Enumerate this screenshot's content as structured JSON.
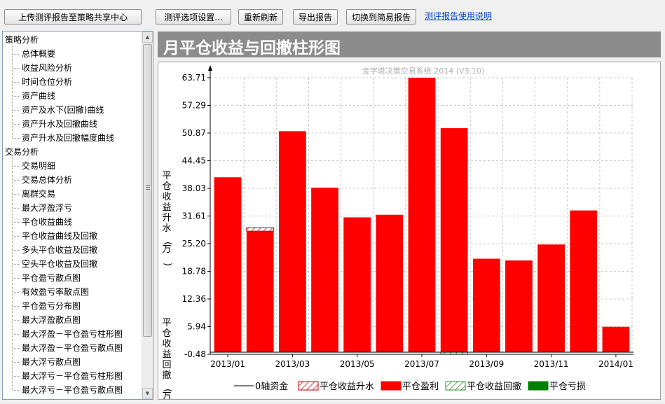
{
  "toolbar": {
    "upload_label": "上传测评报告至策略共享中心",
    "settings_label": "测评选项设置...",
    "refresh_label": "重新刷新",
    "export_label": "导出报告",
    "switch_label": "切换到简易报告",
    "help_link": "测评报告使用说明"
  },
  "sidebar": {
    "groups": [
      {
        "label": "策略分析",
        "items": [
          "总体概要",
          "收益风险分析",
          "时间仓位分析",
          "资产曲线",
          "资产及水下(回撤)曲线",
          "资产升水及回撤曲线",
          "资产升水及回撤幅度曲线"
        ]
      },
      {
        "label": "交易分析",
        "items": [
          "交易明细",
          "交易总体分析",
          "离群交易",
          "最大浮盈浮亏",
          "平仓收益曲线",
          "平仓收益曲线及回撤",
          "多头平仓收益及回撤",
          "空头平仓收益及回撤",
          "平仓盈亏散点图",
          "有效盈亏率散点图",
          "平仓盈亏分布图",
          "最大浮盈散点图",
          "最大浮盈－平仓盈亏柱形图",
          "最大浮盈－平仓盈亏散点图",
          "最大浮亏散点图",
          "最大浮亏－平仓盈亏柱形图",
          "最大浮亏－平仓盈亏散点图"
        ]
      }
    ]
  },
  "title_banner": "月平仓收益与回撤柱形图",
  "colors": {
    "profit": "#ff0000",
    "loss": "#008000",
    "rise_hatch": "#cc0000",
    "drawdown_hatch": "#2e8b2e",
    "banner": "#8c8c8c"
  },
  "chart_data": {
    "type": "bar",
    "watermark": "金字塔决策交易系统 2014 (V3.10)",
    "ylabel_top": "平仓收益升水(万)",
    "ylabel_bottom": "平仓收益回撤(万)",
    "y_ticks": [
      "63.71",
      "57.29",
      "50.87",
      "44.45",
      "38.03",
      "31.61",
      "25.20",
      "18.78",
      "12.36",
      "5.94",
      "-0.48"
    ],
    "ylim": [
      -0.48,
      63.71
    ],
    "x_tick_labels": [
      "2013/01",
      "2013/03",
      "2013/05",
      "2013/07",
      "2013/09",
      "2013/11",
      "2014/01"
    ],
    "categories": [
      "2013/01",
      "2013/02",
      "2013/03",
      "2013/04",
      "2013/05",
      "2013/06",
      "2013/07",
      "2013/08",
      "2013/09",
      "2013/10",
      "2013/11",
      "2013/12",
      "2014/01"
    ],
    "series": [
      {
        "name": "平仓盈利",
        "values": [
          40.6,
          28.1,
          51.3,
          38.2,
          31.3,
          31.9,
          63.7,
          52.0,
          21.7,
          21.3,
          25.0,
          32.9,
          5.9
        ]
      },
      {
        "name": "平仓收益升水",
        "values": [
          0,
          0.5,
          0,
          0,
          0,
          0,
          0,
          0,
          0,
          0,
          0,
          0,
          0
        ]
      },
      {
        "name": "平仓收益回撤",
        "values": [
          0,
          0,
          0,
          0,
          0,
          0,
          0,
          -0.45,
          0,
          0,
          0,
          0,
          0
        ]
      },
      {
        "name": "平仓亏损",
        "values": [
          0,
          0,
          0,
          0,
          0,
          0,
          0,
          0,
          0,
          0,
          0,
          0,
          0
        ]
      }
    ],
    "legend": [
      "0轴资金",
      "平仓收益升水",
      "平仓盈利",
      "平仓收益回撤",
      "平仓亏损"
    ],
    "legend_position": "bottom",
    "grid": true
  }
}
